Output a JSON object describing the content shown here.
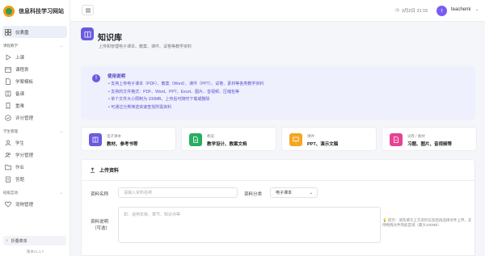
{
  "app": {
    "title": "信息科技学习网站"
  },
  "sidebar": {
    "dashboard": "仪表盘",
    "groups": [
      {
        "title": "课程教学",
        "items": [
          "上课",
          "课程表",
          "学案模板",
          "备课",
          "重难",
          "评分管理"
        ]
      },
      {
        "title": "学生管理",
        "items": [
          "学生",
          "学分管理",
          "作业",
          "答题"
        ]
      },
      {
        "title": "班级互动",
        "items": [
          "宠物管理"
        ]
      }
    ],
    "collapse": "折叠菜单",
    "version": "版本v1.1.7"
  },
  "topbar": {
    "datetime": "3月2日 21:15",
    "user": "teachemi",
    "avatar_letter": "t"
  },
  "page": {
    "title": "知识库",
    "subtitle": "上传和管理电子课本、教案、课件、试卷等教学资料"
  },
  "info": {
    "title": "使用说明",
    "items": [
      "支持上传电子课本（PDF）、教案（Word）、课件（PPT）、试卷、素材等各类教学资料",
      "支持的文件格式：PDF、Word、PPT、Excel、图片、音视频、压缩包等",
      "单个文件大小限制为 100MB，上传后可随时下载或删除",
      "可通过分类筛选快速查找所需资料"
    ]
  },
  "categories": [
    {
      "small": "电子课本",
      "main": "教材、参考书等",
      "color": "#6a5ae0"
    },
    {
      "small": "教案",
      "main": "教学设计、教案文档",
      "color": "#27ae60"
    },
    {
      "small": "课件",
      "main": "PPT、演示文稿",
      "color": "#f5a623"
    },
    {
      "small": "试卷 / 素材",
      "main": "习题、图片、音视频等",
      "color": "#e84393"
    }
  ],
  "upload": {
    "heading": "上传资料",
    "name_label": "资料名称",
    "name_placeholder": "请输入资料名称",
    "category_label": "资料分类",
    "category_value": "电子课本",
    "desc_label_1": "资料说明",
    "desc_label_2": "（可选）",
    "desc_placeholder": "如：适用年级、章节、知识点等",
    "hint": "提示：请先填写上方资料信息后再选择文件上传，支持拖拽文件到此区域（最大100MB）"
  }
}
